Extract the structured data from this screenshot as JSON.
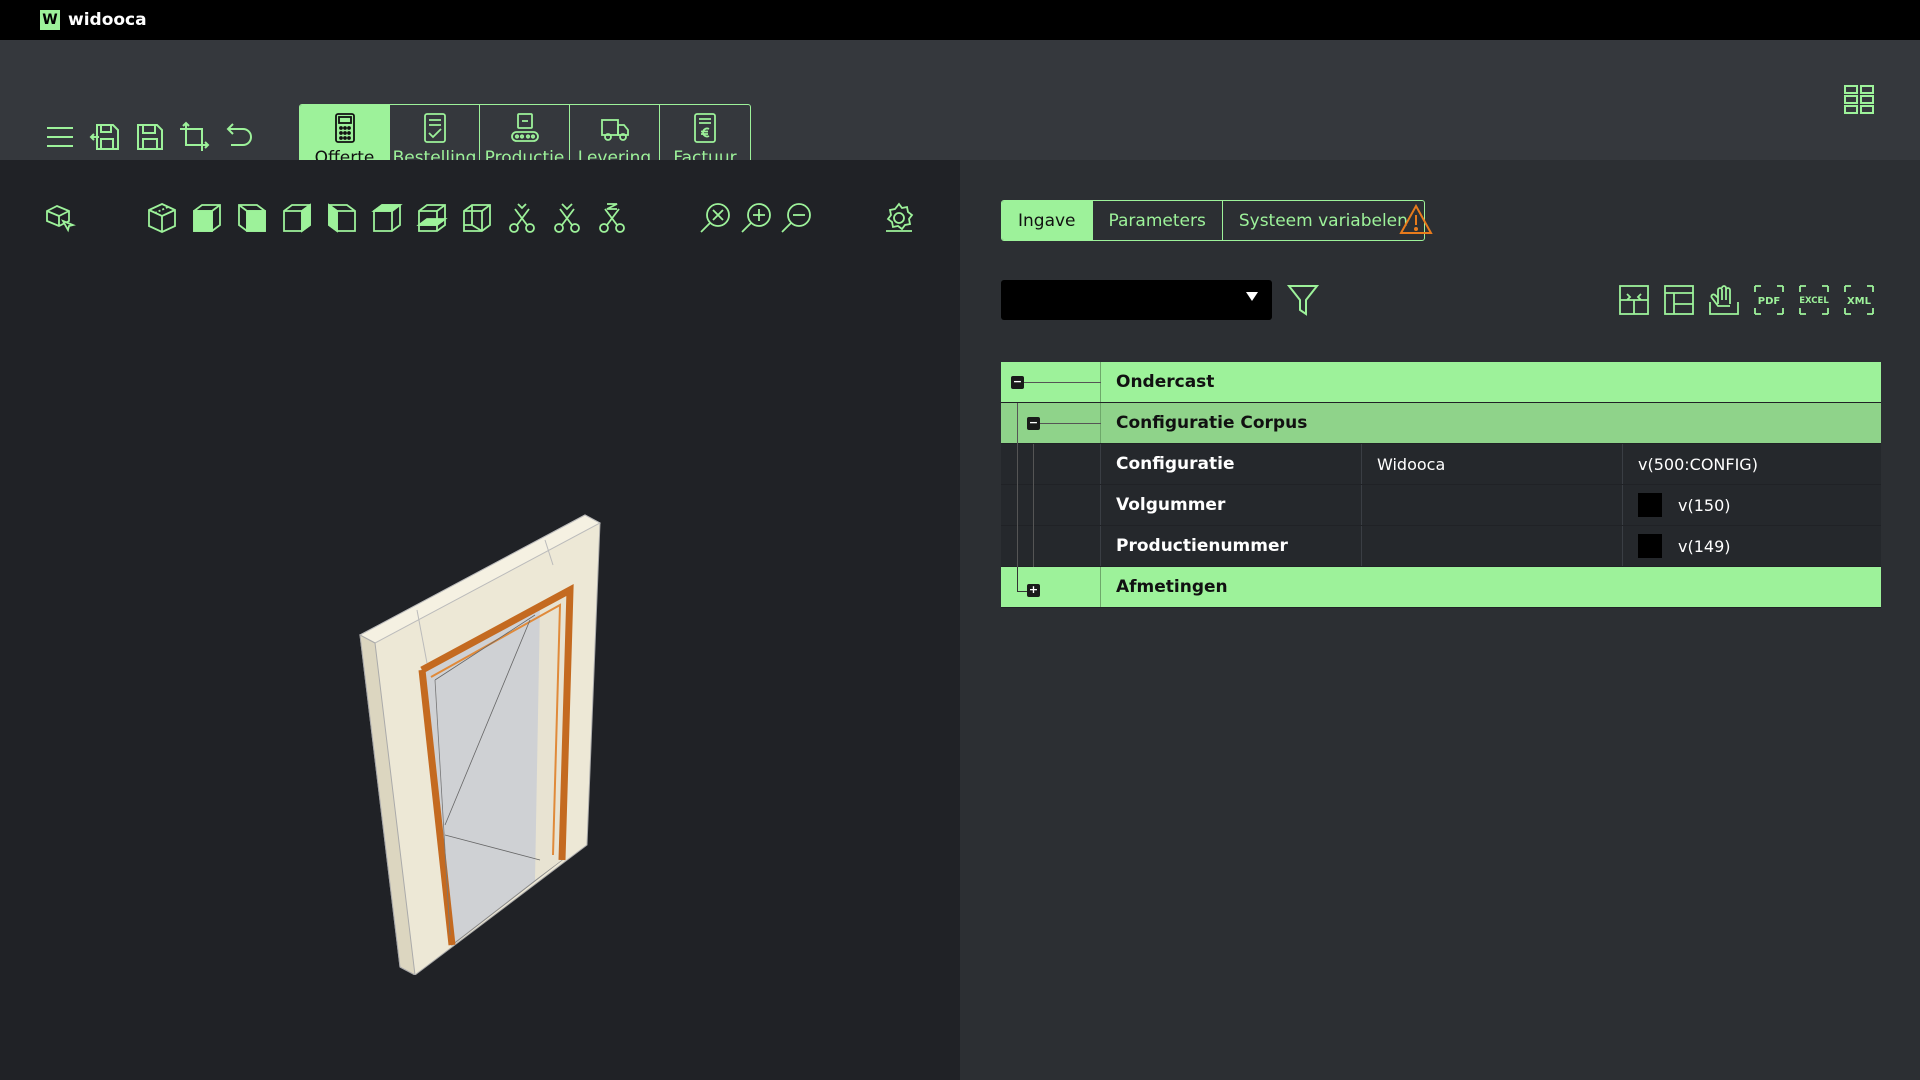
{
  "app": {
    "logo": "W",
    "title": "widooca"
  },
  "toolbar": {
    "icons": [
      "menu-icon",
      "save-as-icon",
      "save-icon",
      "crop-icon",
      "undo-icon",
      "grid-view-icon"
    ],
    "stages": [
      {
        "label": "Offerte",
        "icon": "calculator-icon",
        "active": true
      },
      {
        "label": "Bestelling",
        "icon": "checklist-icon",
        "active": false
      },
      {
        "label": "Productie",
        "icon": "conveyor-icon",
        "active": false
      },
      {
        "label": "Levering",
        "icon": "truck-icon",
        "active": false
      },
      {
        "label": "Factuur",
        "icon": "invoice-icon",
        "active": false
      }
    ]
  },
  "viewer": {
    "tools": [
      "select-icon",
      "iso-view-icon",
      "front-view-icon",
      "left-view-icon",
      "right-view-icon",
      "top-view-icon",
      "bottom-view-icon",
      "back-view-icon",
      "wireframe-view-icon",
      "cut-x-icon",
      "cut-y-icon",
      "cut-z-icon",
      "zoom-fit-icon",
      "zoom-in-icon",
      "zoom-out-icon",
      "settings-icon"
    ]
  },
  "panel": {
    "tabs": [
      {
        "label": "Ingave",
        "active": true
      },
      {
        "label": "Parameters",
        "active": false
      },
      {
        "label": "Systeem variabelen",
        "active": false
      }
    ],
    "select_value": "",
    "export_icons": [
      "layout-icon",
      "panels-icon",
      "hand-stop-icon",
      "pdf-icon",
      "excel-icon",
      "xml-icon"
    ],
    "export_labels": {
      "pdf": "PDF",
      "excel": "EXCEL",
      "xml": "XML"
    },
    "tree": {
      "ondercast": "Ondercast",
      "configuratie_corpus": "Configuratie Corpus",
      "rows": [
        {
          "name": "Configuratie",
          "value": "Widooca",
          "var": "v(500:CONFIG)",
          "swatch": false
        },
        {
          "name": "Volgummer",
          "value": "",
          "var": "v(150)",
          "swatch": true
        },
        {
          "name": "Productienummer",
          "value": "",
          "var": "v(149)",
          "swatch": true
        }
      ],
      "afmetingen": "Afmetingen"
    }
  },
  "colors": {
    "accent": "#9df29a",
    "warning": "#e87b1c"
  }
}
